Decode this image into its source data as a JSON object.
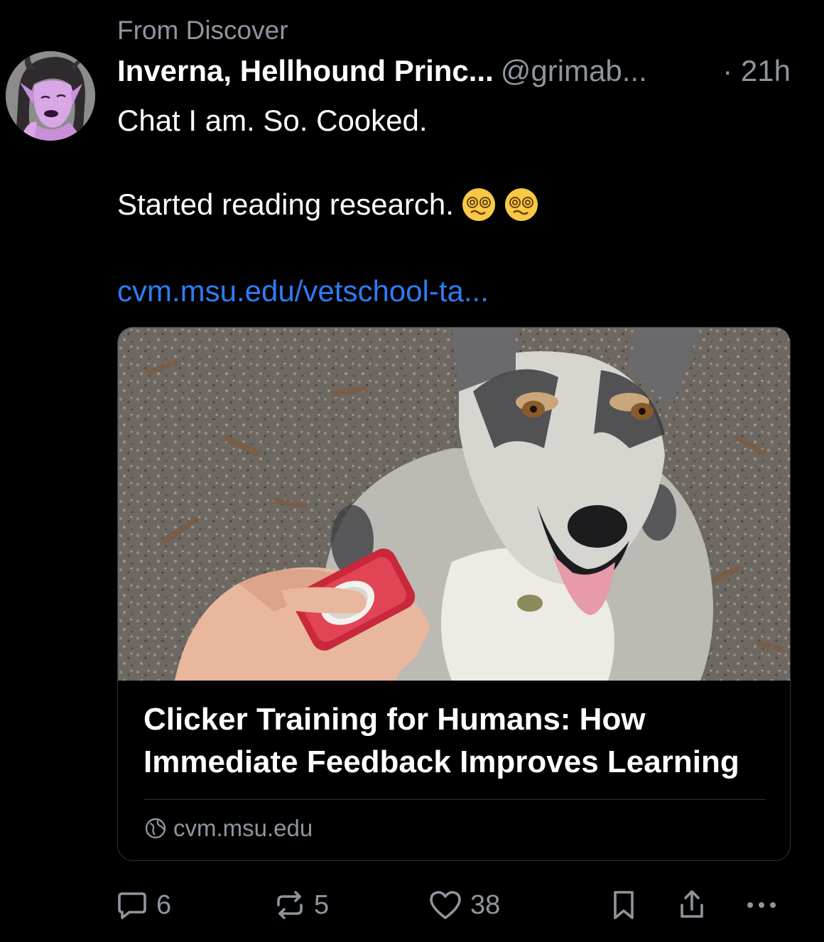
{
  "post": {
    "context_label": "From Discover",
    "author": {
      "display_name": "Inverna, Hellhound Princ...",
      "handle": "@grimab...",
      "avatar_icon": "avatar-image"
    },
    "timestamp": "· 21h",
    "text_line_1": "Chat I am. So. Cooked.",
    "text_line_2": "Started reading research.",
    "emoji": [
      "face-with-spiral-eyes",
      "face-with-spiral-eyes"
    ],
    "link_text": "cvm.msu.edu/vetschool-ta..."
  },
  "link_card": {
    "image_icon": "dog-with-clicker-photo",
    "title": "Clicker Training for Humans: How Immediate Feedback Improves Learning",
    "domain": "cvm.msu.edu",
    "domain_icon": "globe-icon"
  },
  "actions": {
    "reply": {
      "icon": "reply-icon",
      "count": "6"
    },
    "repost": {
      "icon": "repost-icon",
      "count": "5"
    },
    "like": {
      "icon": "heart-icon",
      "count": "38"
    },
    "bookmark": {
      "icon": "bookmark-icon"
    },
    "share": {
      "icon": "share-icon"
    },
    "more": {
      "icon": "more-icon"
    }
  },
  "colors": {
    "background": "#000000",
    "text_primary": "#ffffff",
    "text_secondary": "#8e959e",
    "link": "#2f7bf5",
    "card_border": "#2e3238"
  }
}
